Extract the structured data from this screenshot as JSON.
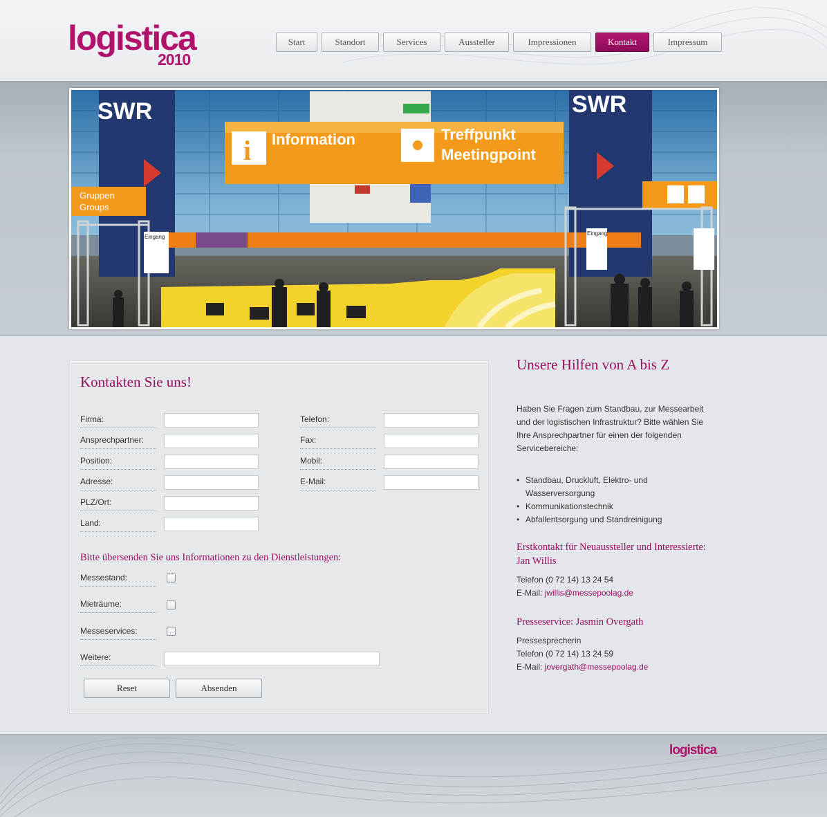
{
  "brand": {
    "logo_word": "logistica",
    "logo_year": "2010",
    "accent_color": "#9a0d60"
  },
  "nav": {
    "items": [
      {
        "label": "Start",
        "active": false
      },
      {
        "label": "Standort",
        "active": false
      },
      {
        "label": "Services",
        "active": false
      },
      {
        "label": "Aussteller",
        "active": false
      },
      {
        "label": "Impressionen",
        "active": false
      },
      {
        "label": "Kontakt",
        "active": true
      },
      {
        "label": "Impressum",
        "active": false
      }
    ]
  },
  "banner": {
    "sign_information": "Information",
    "sign_treffpunkt": "Treffpunkt",
    "sign_meetingpoint": "Meetingpoint",
    "sign_swr": "SWR",
    "sign_gruppen": "Gruppen",
    "sign_groups": "Groups",
    "sign_eingang": "Eingang"
  },
  "form": {
    "title": "Kontakten Sie uns!",
    "left_fields": [
      "Firma:",
      "Ansprechpartner:",
      "Position:",
      "Adresse:",
      "PLZ/Ort:",
      "Land:"
    ],
    "right_fields": [
      "Telefon:",
      "Fax:",
      "Mobil:",
      "E-Mail:"
    ],
    "info_heading": "Bitte übersenden Sie uns Informationen zu den Dienstleistungen:",
    "checkbox_fields": [
      "Messestand:",
      "Mieträume:",
      "Messeservices:"
    ],
    "other_label": "Weitere:",
    "reset_label": "Reset",
    "submit_label": "Absenden"
  },
  "sidebar": {
    "title": "Unsere Hilfen von A bis Z",
    "intro": "Haben Sie Fragen zum Standbau, zur Messearbeit und der logistischen Infrastruktur? Bitte wählen Sie Ihre Ansprechpartner für einen der folgenden Servicebereiche:",
    "services": [
      "Standbau, Druckluft, Elektro- und Wasserversorgung",
      "Kommunikationstechnik",
      "Abfallentsorgung und Standreinigung"
    ],
    "contact1": {
      "heading": "Erstkontakt für Neuaussteller und Interessierte: Jan Willis",
      "phone": "Telefon (0 72 14) 13 24 54",
      "email_label": "E-Mail:",
      "email": "jwillis@messepoolag.de"
    },
    "contact2": {
      "heading": "Presseservice: Jasmin Overgath",
      "role": "Pressesprecherin",
      "phone": "Telefon (0 72 14) 13 24 59",
      "email_label": "E-Mail:",
      "email": "jovergath@messepoolag.de"
    }
  },
  "footer": {
    "logo": "logistica"
  }
}
